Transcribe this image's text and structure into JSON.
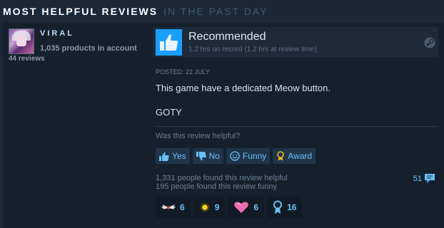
{
  "header": {
    "title": "MOST HELPFUL REVIEWS",
    "subtitle": "IN THE PAST DAY"
  },
  "author": {
    "persona_name": "VIRAL",
    "products_owned": "1,035 products in account",
    "reviews_count": "44 reviews",
    "avatar_icon": "avatar-image"
  },
  "review": {
    "vote_title": "Recommended",
    "hours": "1.2 hrs on record (1.2 hrs at review time)",
    "vote_icon": "thumbs-up-icon",
    "platform_icon": "steam-icon",
    "posted": "POSTED: 22 JULY",
    "body_lines": [
      "This game have a dedicated Meow button.",
      "GOTY"
    ],
    "helpful_question": "Was this review helpful?",
    "buttons": {
      "yes": "Yes",
      "no": "No",
      "funny": "Funny",
      "award": "Award"
    },
    "helpful_count_text": "1,331 people found this review helpful",
    "funny_count_text": "195 people found this review funny",
    "comment_count": "51",
    "awards": [
      {
        "icon": "winged-award-icon",
        "count": "6"
      },
      {
        "icon": "sun-award-icon",
        "count": "9"
      },
      {
        "icon": "heart-award-icon",
        "count": "6"
      },
      {
        "icon": "ribbon-award-icon",
        "count": "16"
      }
    ]
  },
  "colors": {
    "background": "#1b2838",
    "panel": "#16202d",
    "accent": "#67c1f5",
    "recommend": "#1a9fff",
    "text_muted": "#6b7f93"
  }
}
